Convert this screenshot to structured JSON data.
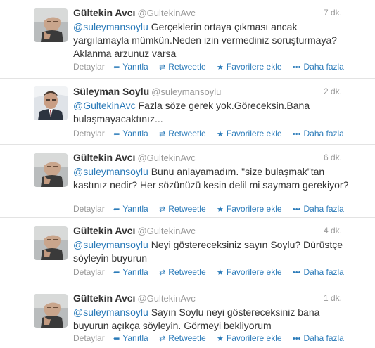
{
  "tweets": [
    {
      "fullname": "Gültekin Avcı",
      "username": "@GultekinAvc",
      "time": "7 dk.",
      "mention": "@suleymansoylu",
      "text_rest": " Gerçeklerin ortaya çıkması ancak yargılamayla mümkün.Neden izin vermediniz soruşturmaya? Aklanma arzunuz varsa",
      "avatar_icon": "avatar-gultekin"
    },
    {
      "fullname": "Süleyman Soylu",
      "username": "@suleymansoylu",
      "time": "2 dk.",
      "mention": "@GultekinAvc",
      "text_rest": " Fazla söze gerek yok.Göreceksin.Bana bulaşmayacaktınız...",
      "avatar_icon": "avatar-suleyman"
    },
    {
      "fullname": "Gültekin Avcı",
      "username": "@GultekinAvc",
      "time": "6 dk.",
      "mention": "@suleymansoylu",
      "text_rest": " Bunu anlayamadım. \"size bulaşmak\"tan kastınız nedir? Her sözünüzü kesin delil mi saymam gerekiyor?",
      "avatar_icon": "avatar-gultekin"
    },
    {
      "fullname": "Gültekin Avcı",
      "username": "@GultekinAvc",
      "time": "4 dk.",
      "mention": "@suleymansoylu",
      "text_rest": " Neyi göstereceksiniz sayın Soylu? Dürüstçe söyleyin buyurun",
      "avatar_icon": "avatar-gultekin"
    },
    {
      "fullname": "Gültekin Avcı",
      "username": "@GultekinAvc",
      "time": "1 dk.",
      "mention": "@suleymansoylu",
      "text_rest": " Sayın Soylu neyi göstereceksiniz bana buyurun açıkça söyleyin. Görmeyi bekliyorum",
      "avatar_icon": "avatar-gultekin"
    }
  ],
  "actions": {
    "details": "Detaylar",
    "reply": "Yanıtla",
    "retweet": "Retweetle",
    "favorite": "Favorilere ekle",
    "more": "Daha fazla",
    "reply_icon": "reply-icon",
    "retweet_icon": "retweet-icon",
    "favorite_icon": "star-icon",
    "more_icon": "ellipsis-icon"
  },
  "colors": {
    "link": "#2b7bb9",
    "meta": "#999999",
    "text": "#333333",
    "divider": "#e3e3e3"
  }
}
